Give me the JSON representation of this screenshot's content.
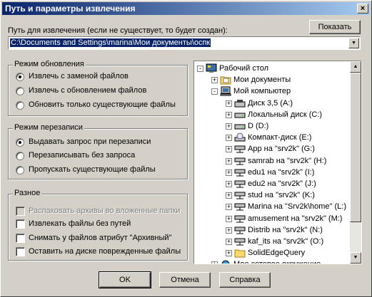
{
  "window": {
    "title": "Путь и параметры извлечения",
    "close_label": "×"
  },
  "path": {
    "label": "Путь для извлечения (если не существует, то будет создан):",
    "value": "C:\\Documents and Settings\\marina\\Мои документы\\ocпк",
    "show_button": "Показать"
  },
  "update_mode": {
    "title": "Режим обновления",
    "options": [
      {
        "label": "Извлечь с заменой файлов",
        "checked": true
      },
      {
        "label": "Извлечь с обновлением файлов",
        "checked": false
      },
      {
        "label": "Обновить только существующие файлы",
        "checked": false
      }
    ]
  },
  "overwrite_mode": {
    "title": "Режим перезаписи",
    "options": [
      {
        "label": "Выдавать запрос при перезаписи",
        "checked": true
      },
      {
        "label": "Перезаписывать без запроса",
        "checked": false
      },
      {
        "label": "Пропускать существующие файлы",
        "checked": false
      }
    ]
  },
  "misc": {
    "title": "Разное",
    "options": [
      {
        "label": "Распаковать архивы во вложенные папки",
        "checked": false,
        "disabled": true
      },
      {
        "label": "Извлекать файлы без путей",
        "checked": false,
        "disabled": false
      },
      {
        "label": "Снимать у файлов атрибут \"Архивный\"",
        "checked": false,
        "disabled": false
      },
      {
        "label": "Оставить на диске поврежденные файлы",
        "checked": false,
        "disabled": false
      }
    ]
  },
  "tree": {
    "items": [
      {
        "label": "Рабочий стол",
        "icon": "desktop-icon",
        "level": 0,
        "expander": "-"
      },
      {
        "label": "Мои документы",
        "icon": "folder-documents-icon",
        "level": 1,
        "expander": "+"
      },
      {
        "label": "Мой компьютер",
        "icon": "computer-icon",
        "level": 1,
        "expander": "-"
      },
      {
        "label": "Диск 3,5 (A:)",
        "icon": "floppy-icon",
        "level": 2,
        "expander": "+"
      },
      {
        "label": "Локальный диск (C:)",
        "icon": "hard-drive-icon",
        "level": 2,
        "expander": "+"
      },
      {
        "label": "D (D:)",
        "icon": "hard-drive-icon",
        "level": 2,
        "expander": "+"
      },
      {
        "label": "Компакт-диск (E:)",
        "icon": "cd-drive-icon",
        "level": 2,
        "expander": "+"
      },
      {
        "label": "App на \"srv2k\" (G:)",
        "icon": "network-drive-icon",
        "level": 2,
        "expander": "+"
      },
      {
        "label": "samrab на \"srv2k\" (H:)",
        "icon": "network-drive-icon",
        "level": 2,
        "expander": "+"
      },
      {
        "label": "edu1 на \"srv2k\" (I:)",
        "icon": "network-drive-icon",
        "level": 2,
        "expander": "+"
      },
      {
        "label": "edu2 на \"srv2k\" (J:)",
        "icon": "network-drive-icon",
        "level": 2,
        "expander": "+"
      },
      {
        "label": "stud на \"srv2k\" (K:)",
        "icon": "network-drive-icon",
        "level": 2,
        "expander": "+"
      },
      {
        "label": "Marina на \"Srv2k\\home\" (L:)",
        "icon": "network-drive-icon",
        "level": 2,
        "expander": "+"
      },
      {
        "label": "amusement на \"srv2k\" (M:)",
        "icon": "network-drive-icon",
        "level": 2,
        "expander": "+"
      },
      {
        "label": "Distrib на \"srv2k\" (N:)",
        "icon": "network-drive-icon",
        "level": 2,
        "expander": "+"
      },
      {
        "label": "kaf_its на \"srv2k\" (O:)",
        "icon": "network-drive-icon",
        "level": 2,
        "expander": "+"
      },
      {
        "label": "SolidEdgeQuery",
        "icon": "folder-icon",
        "level": 2,
        "expander": "+"
      },
      {
        "label": "Мое сетевое окружение",
        "icon": "network-places-icon",
        "level": 1,
        "expander": "+"
      }
    ]
  },
  "buttons": {
    "ok": "OK",
    "cancel": "Отмена",
    "help": "Справка"
  },
  "colors": {
    "title_start": "#0a246a",
    "title_end": "#a6caf0",
    "face": "#d4d0c8",
    "selection": "#0a246a"
  }
}
